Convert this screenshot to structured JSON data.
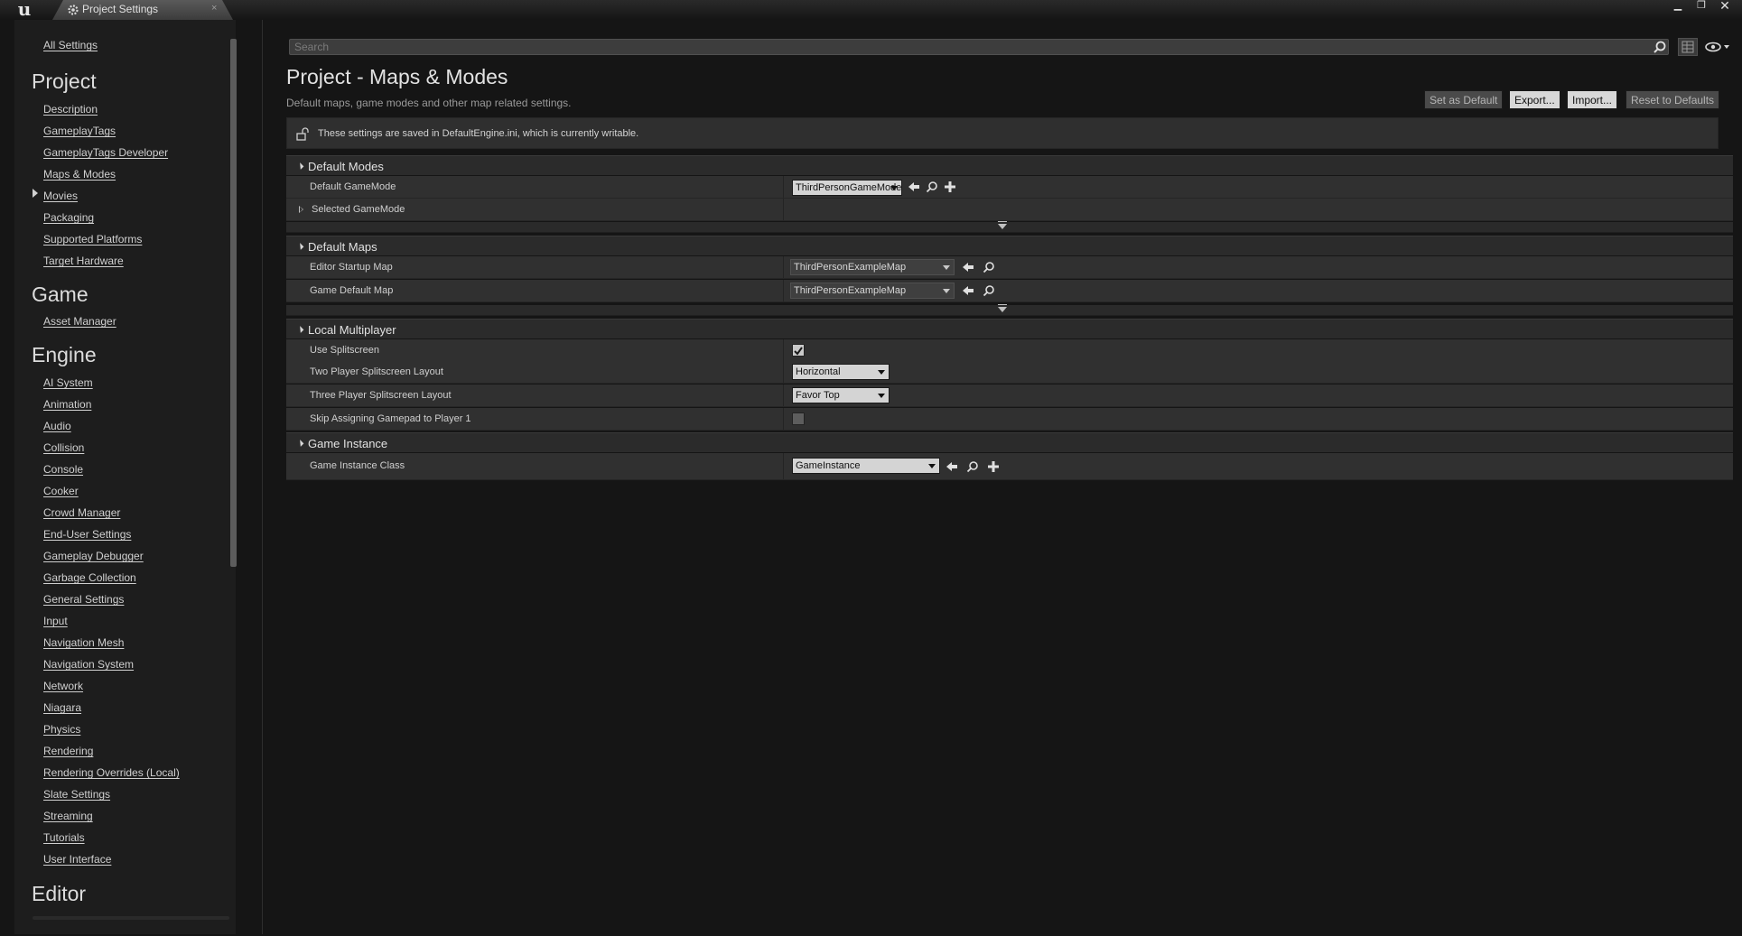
{
  "window": {
    "tab_label": "Project Settings",
    "tab_close": "×",
    "min": "▁",
    "max": "❐",
    "close": "✕"
  },
  "nav": {
    "all_settings": "All Settings",
    "project_heading": "Project",
    "project_items": [
      "Description",
      "GameplayTags",
      "GameplayTags Developer",
      "Maps & Modes",
      "Movies",
      "Packaging",
      "Supported Platforms",
      "Target Hardware"
    ],
    "game_heading": "Game",
    "game_items": [
      "Asset Manager"
    ],
    "engine_heading": "Engine",
    "engine_items": [
      "AI System",
      "Animation",
      "Audio",
      "Collision",
      "Console",
      "Cooker",
      "Crowd Manager",
      "End-User Settings",
      "Gameplay Debugger",
      "Garbage Collection",
      "General Settings",
      "Input",
      "Navigation Mesh",
      "Navigation System",
      "Network",
      "Niagara",
      "Physics",
      "Rendering",
      "Rendering Overrides (Local)",
      "Slate Settings",
      "Streaming",
      "Tutorials",
      "User Interface"
    ],
    "editor_heading": "Editor",
    "selected_item": "Maps & Modes"
  },
  "search": {
    "placeholder": "Search"
  },
  "page": {
    "title": "Project - Maps & Modes",
    "subtitle": "Default maps, game modes and other map related settings."
  },
  "buttons": {
    "set_default": "Set as Default",
    "export": "Export...",
    "import": "Import...",
    "reset": "Reset to Defaults"
  },
  "info": {
    "text": "These settings are saved in DefaultEngine.ini, which is currently writable."
  },
  "sections": {
    "default_modes": {
      "title": "Default Modes",
      "default_gamemode_label": "Default GameMode",
      "default_gamemode_value": "ThirdPersonGameMode",
      "selected_gamemode_label": "Selected GameMode"
    },
    "default_maps": {
      "title": "Default Maps",
      "editor_startup_label": "Editor Startup Map",
      "editor_startup_value": "ThirdPersonExampleMap",
      "game_default_label": "Game Default Map",
      "game_default_value": "ThirdPersonExampleMap"
    },
    "local_multiplayer": {
      "title": "Local Multiplayer",
      "use_splitscreen_label": "Use Splitscreen",
      "use_splitscreen_checked": true,
      "two_player_label": "Two Player Splitscreen Layout",
      "two_player_value": "Horizontal",
      "three_player_label": "Three Player Splitscreen Layout",
      "three_player_value": "Favor Top",
      "skip_gamepad_label": "Skip Assigning Gamepad to Player 1",
      "skip_gamepad_checked": false
    },
    "game_instance": {
      "title": "Game Instance",
      "class_label": "Game Instance Class",
      "class_value": "GameInstance"
    }
  },
  "colors": {
    "background": "#151515",
    "panel": "#303030",
    "header": "#2b2b2b",
    "text": "#c8c8c8",
    "combo_light": "#d4d4d4"
  }
}
